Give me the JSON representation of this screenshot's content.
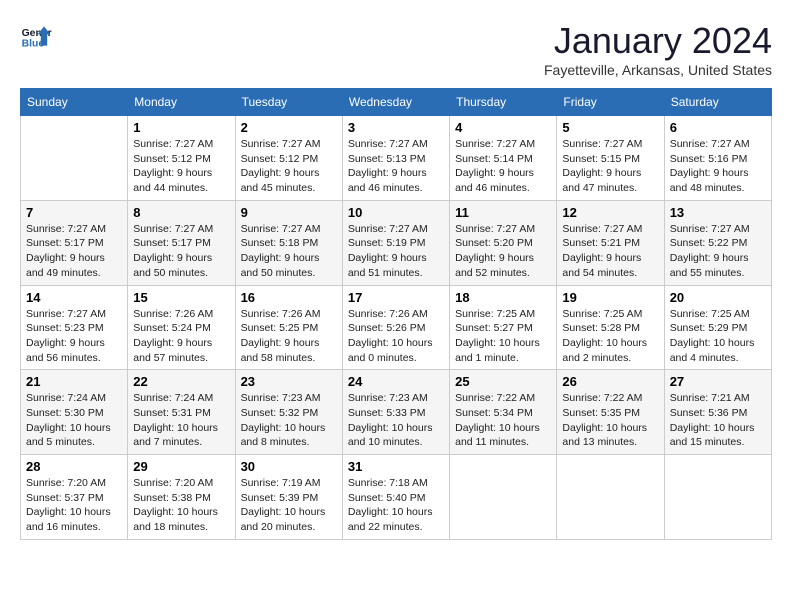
{
  "header": {
    "logo_line1": "General",
    "logo_line2": "Blue",
    "month": "January 2024",
    "location": "Fayetteville, Arkansas, United States"
  },
  "weekdays": [
    "Sunday",
    "Monday",
    "Tuesday",
    "Wednesday",
    "Thursday",
    "Friday",
    "Saturday"
  ],
  "weeks": [
    [
      {
        "day": "",
        "info": ""
      },
      {
        "day": "1",
        "info": "Sunrise: 7:27 AM\nSunset: 5:12 PM\nDaylight: 9 hours\nand 44 minutes."
      },
      {
        "day": "2",
        "info": "Sunrise: 7:27 AM\nSunset: 5:12 PM\nDaylight: 9 hours\nand 45 minutes."
      },
      {
        "day": "3",
        "info": "Sunrise: 7:27 AM\nSunset: 5:13 PM\nDaylight: 9 hours\nand 46 minutes."
      },
      {
        "day": "4",
        "info": "Sunrise: 7:27 AM\nSunset: 5:14 PM\nDaylight: 9 hours\nand 46 minutes."
      },
      {
        "day": "5",
        "info": "Sunrise: 7:27 AM\nSunset: 5:15 PM\nDaylight: 9 hours\nand 47 minutes."
      },
      {
        "day": "6",
        "info": "Sunrise: 7:27 AM\nSunset: 5:16 PM\nDaylight: 9 hours\nand 48 minutes."
      }
    ],
    [
      {
        "day": "7",
        "info": "Sunrise: 7:27 AM\nSunset: 5:17 PM\nDaylight: 9 hours\nand 49 minutes."
      },
      {
        "day": "8",
        "info": "Sunrise: 7:27 AM\nSunset: 5:17 PM\nDaylight: 9 hours\nand 50 minutes."
      },
      {
        "day": "9",
        "info": "Sunrise: 7:27 AM\nSunset: 5:18 PM\nDaylight: 9 hours\nand 50 minutes."
      },
      {
        "day": "10",
        "info": "Sunrise: 7:27 AM\nSunset: 5:19 PM\nDaylight: 9 hours\nand 51 minutes."
      },
      {
        "day": "11",
        "info": "Sunrise: 7:27 AM\nSunset: 5:20 PM\nDaylight: 9 hours\nand 52 minutes."
      },
      {
        "day": "12",
        "info": "Sunrise: 7:27 AM\nSunset: 5:21 PM\nDaylight: 9 hours\nand 54 minutes."
      },
      {
        "day": "13",
        "info": "Sunrise: 7:27 AM\nSunset: 5:22 PM\nDaylight: 9 hours\nand 55 minutes."
      }
    ],
    [
      {
        "day": "14",
        "info": "Sunrise: 7:27 AM\nSunset: 5:23 PM\nDaylight: 9 hours\nand 56 minutes."
      },
      {
        "day": "15",
        "info": "Sunrise: 7:26 AM\nSunset: 5:24 PM\nDaylight: 9 hours\nand 57 minutes."
      },
      {
        "day": "16",
        "info": "Sunrise: 7:26 AM\nSunset: 5:25 PM\nDaylight: 9 hours\nand 58 minutes."
      },
      {
        "day": "17",
        "info": "Sunrise: 7:26 AM\nSunset: 5:26 PM\nDaylight: 10 hours\nand 0 minutes."
      },
      {
        "day": "18",
        "info": "Sunrise: 7:25 AM\nSunset: 5:27 PM\nDaylight: 10 hours\nand 1 minute."
      },
      {
        "day": "19",
        "info": "Sunrise: 7:25 AM\nSunset: 5:28 PM\nDaylight: 10 hours\nand 2 minutes."
      },
      {
        "day": "20",
        "info": "Sunrise: 7:25 AM\nSunset: 5:29 PM\nDaylight: 10 hours\nand 4 minutes."
      }
    ],
    [
      {
        "day": "21",
        "info": "Sunrise: 7:24 AM\nSunset: 5:30 PM\nDaylight: 10 hours\nand 5 minutes."
      },
      {
        "day": "22",
        "info": "Sunrise: 7:24 AM\nSunset: 5:31 PM\nDaylight: 10 hours\nand 7 minutes."
      },
      {
        "day": "23",
        "info": "Sunrise: 7:23 AM\nSunset: 5:32 PM\nDaylight: 10 hours\nand 8 minutes."
      },
      {
        "day": "24",
        "info": "Sunrise: 7:23 AM\nSunset: 5:33 PM\nDaylight: 10 hours\nand 10 minutes."
      },
      {
        "day": "25",
        "info": "Sunrise: 7:22 AM\nSunset: 5:34 PM\nDaylight: 10 hours\nand 11 minutes."
      },
      {
        "day": "26",
        "info": "Sunrise: 7:22 AM\nSunset: 5:35 PM\nDaylight: 10 hours\nand 13 minutes."
      },
      {
        "day": "27",
        "info": "Sunrise: 7:21 AM\nSunset: 5:36 PM\nDaylight: 10 hours\nand 15 minutes."
      }
    ],
    [
      {
        "day": "28",
        "info": "Sunrise: 7:20 AM\nSunset: 5:37 PM\nDaylight: 10 hours\nand 16 minutes."
      },
      {
        "day": "29",
        "info": "Sunrise: 7:20 AM\nSunset: 5:38 PM\nDaylight: 10 hours\nand 18 minutes."
      },
      {
        "day": "30",
        "info": "Sunrise: 7:19 AM\nSunset: 5:39 PM\nDaylight: 10 hours\nand 20 minutes."
      },
      {
        "day": "31",
        "info": "Sunrise: 7:18 AM\nSunset: 5:40 PM\nDaylight: 10 hours\nand 22 minutes."
      },
      {
        "day": "",
        "info": ""
      },
      {
        "day": "",
        "info": ""
      },
      {
        "day": "",
        "info": ""
      }
    ]
  ]
}
